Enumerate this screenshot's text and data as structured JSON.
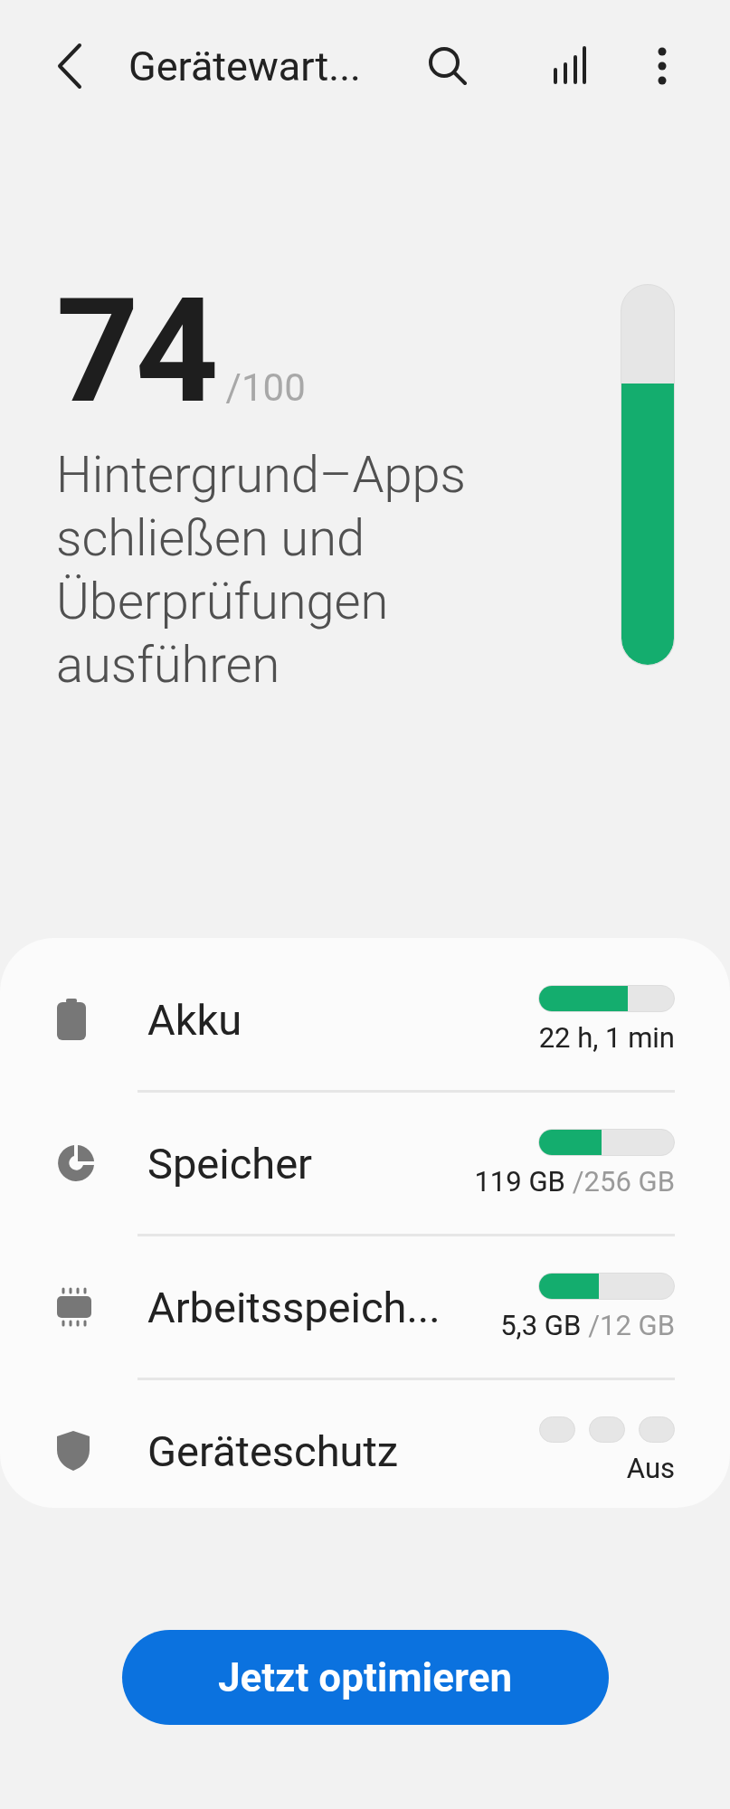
{
  "header": {
    "title": "Gerätewart..."
  },
  "score": {
    "value": "74",
    "max": "/100",
    "level": 0.74
  },
  "description": "Hintergrund–Apps schließen und Überprüfungen ausführen",
  "items": [
    {
      "kind": "bar",
      "label": "Akku",
      "level": 0.66,
      "value": "22 h, 1 min"
    },
    {
      "kind": "bar",
      "label": "Speicher",
      "level": 0.46,
      "value": "119 GB",
      "total": "/256 GB"
    },
    {
      "kind": "bar",
      "label": "Arbeitsspeich...",
      "level": 0.44,
      "value": "5,3 GB",
      "total": "/12 GB"
    },
    {
      "kind": "dots",
      "label": "Geräteschutz",
      "on": false,
      "value": "Aus"
    }
  ],
  "button": "Jetzt optimieren"
}
